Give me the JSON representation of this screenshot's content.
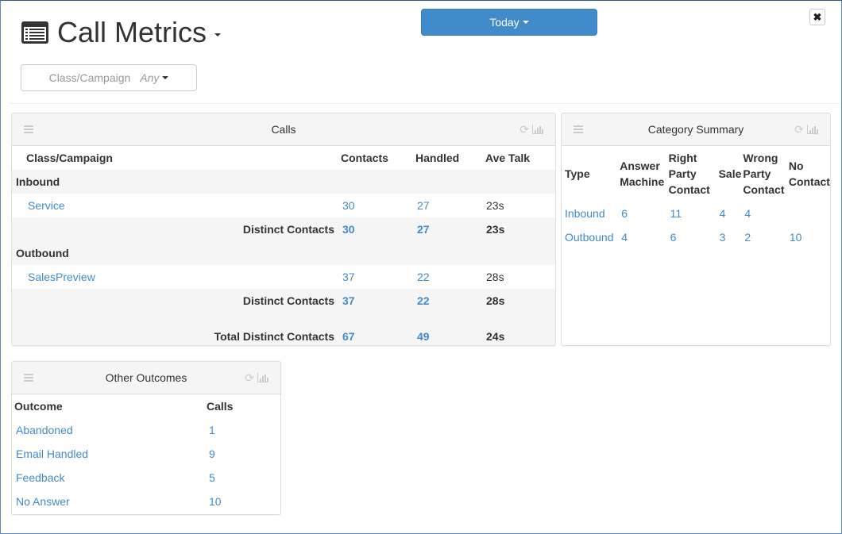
{
  "header": {
    "title": "Call Metrics",
    "title_icon": "list-alt-icon",
    "date_range_label": "Today",
    "close_icon": "close-icon",
    "filter": {
      "label": "Class/Campaign",
      "value": "Any"
    }
  },
  "colors": {
    "accent": "#428bca",
    "link": "#428bca",
    "panel_header": "#f5f5f5"
  },
  "calls_panel": {
    "title": "Calls",
    "columns": [
      "Class/Campaign",
      "Contacts",
      "Handled",
      "Ave Talk"
    ],
    "groups": [
      {
        "name": "Inbound",
        "rows": [
          {
            "campaign": "Service",
            "contacts": "30",
            "handled": "27",
            "ave_talk": "23s"
          }
        ],
        "subtotal": {
          "label": "Distinct Contacts",
          "contacts": "30",
          "handled": "27",
          "ave_talk": "23s"
        }
      },
      {
        "name": "Outbound",
        "rows": [
          {
            "campaign": "SalesPreview",
            "contacts": "37",
            "handled": "22",
            "ave_talk": "28s"
          }
        ],
        "subtotal": {
          "label": "Distinct Contacts",
          "contacts": "37",
          "handled": "22",
          "ave_talk": "28s"
        }
      }
    ],
    "total": {
      "label": "Total Distinct Contacts",
      "contacts": "67",
      "handled": "49",
      "ave_talk": "24s"
    }
  },
  "category_panel": {
    "title": "Category Summary",
    "columns": [
      {
        "line1": "",
        "line2": "Type",
        "line3": ""
      },
      {
        "line1": "Answer",
        "line2": "Machine",
        "line3": ""
      },
      {
        "line1": "Right",
        "line2": "Party",
        "line3": "Contact"
      },
      {
        "line1": "",
        "line2": "Sale",
        "line3": ""
      },
      {
        "line1": "Wrong",
        "line2": "Party",
        "line3": "Contact"
      },
      {
        "line1": "No",
        "line2": "Contact",
        "line3": ""
      }
    ],
    "rows": [
      {
        "type": "Inbound",
        "answer_machine": "6",
        "right_party": "11",
        "sale": "4",
        "wrong_party": "4",
        "no_contact": ""
      },
      {
        "type": "Outbound",
        "answer_machine": "4",
        "right_party": "6",
        "sale": "3",
        "wrong_party": "2",
        "no_contact": "10"
      }
    ]
  },
  "outcomes_panel": {
    "title": "Other Outcomes",
    "columns": [
      "Outcome",
      "Calls"
    ],
    "rows": [
      {
        "outcome": "Abandoned",
        "calls": "1"
      },
      {
        "outcome": "Email Handled",
        "calls": "9"
      },
      {
        "outcome": "Feedback",
        "calls": "5"
      },
      {
        "outcome": "No Answer",
        "calls": "10"
      }
    ]
  }
}
